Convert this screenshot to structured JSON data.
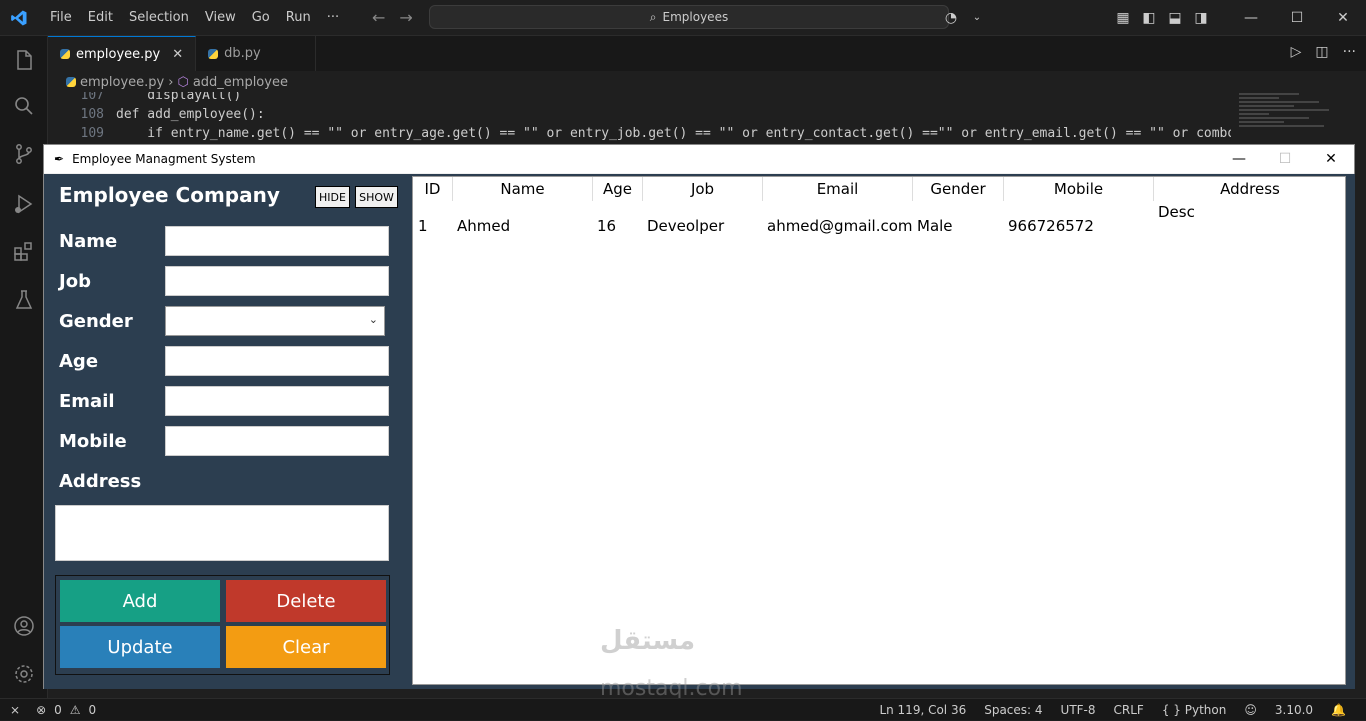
{
  "titlebar": {
    "menu": [
      "File",
      "Edit",
      "Selection",
      "View",
      "Go",
      "Run",
      "···"
    ],
    "search_text": "Employees"
  },
  "tabs": [
    {
      "label": "employee.py",
      "active": true
    },
    {
      "label": "db.py",
      "active": false
    }
  ],
  "breadcrumb": {
    "file": "employee.py",
    "symbol": "add_employee"
  },
  "code": [
    {
      "line": "107",
      "text": "    displayAll()"
    },
    {
      "line": "108",
      "text": "def add_employee():"
    },
    {
      "line": "109",
      "text": "    if entry_name.get() == \"\" or entry_age.get() == \"\" or entry_job.get() == \"\" or entry_contact.get() ==\"\" or entry_email.get() == \"\" or comboGe"
    }
  ],
  "tk": {
    "window_title": "Employee Managment System",
    "company": "Employee Company",
    "hide_label": "HIDE",
    "show_label": "SHOW",
    "labels": {
      "name": "Name",
      "job": "Job",
      "gender": "Gender",
      "age": "Age",
      "email": "Email",
      "mobile": "Mobile",
      "address": "Address"
    },
    "buttons": {
      "add": "Add",
      "delete": "Delete",
      "update": "Update",
      "clear": "Clear"
    },
    "colors": {
      "panel": "#2c3e50",
      "add": "#16a085",
      "delete": "#c0392b",
      "update": "#2980b9",
      "clear": "#f39c12"
    },
    "table": {
      "columns": [
        "ID",
        "Name",
        "Age",
        "Job",
        "Email",
        "Gender",
        "Mobile",
        "Address"
      ],
      "rows": [
        {
          "id": "1",
          "name": "Ahmed",
          "age": "16",
          "job": "Deveolper",
          "email": "ahmed@gmail.com",
          "gender": "Male",
          "mobile": "966726572",
          "address": "Desc"
        }
      ]
    }
  },
  "status": {
    "errors": "0",
    "warnings": "0",
    "position": "Ln 119, Col 36",
    "spaces": "Spaces: 4",
    "encoding": "UTF-8",
    "eol": "CRLF",
    "language": "Python",
    "version": "3.10.0"
  },
  "watermark": {
    "arabic": "مستقل",
    "latin": "mostaql.com"
  }
}
